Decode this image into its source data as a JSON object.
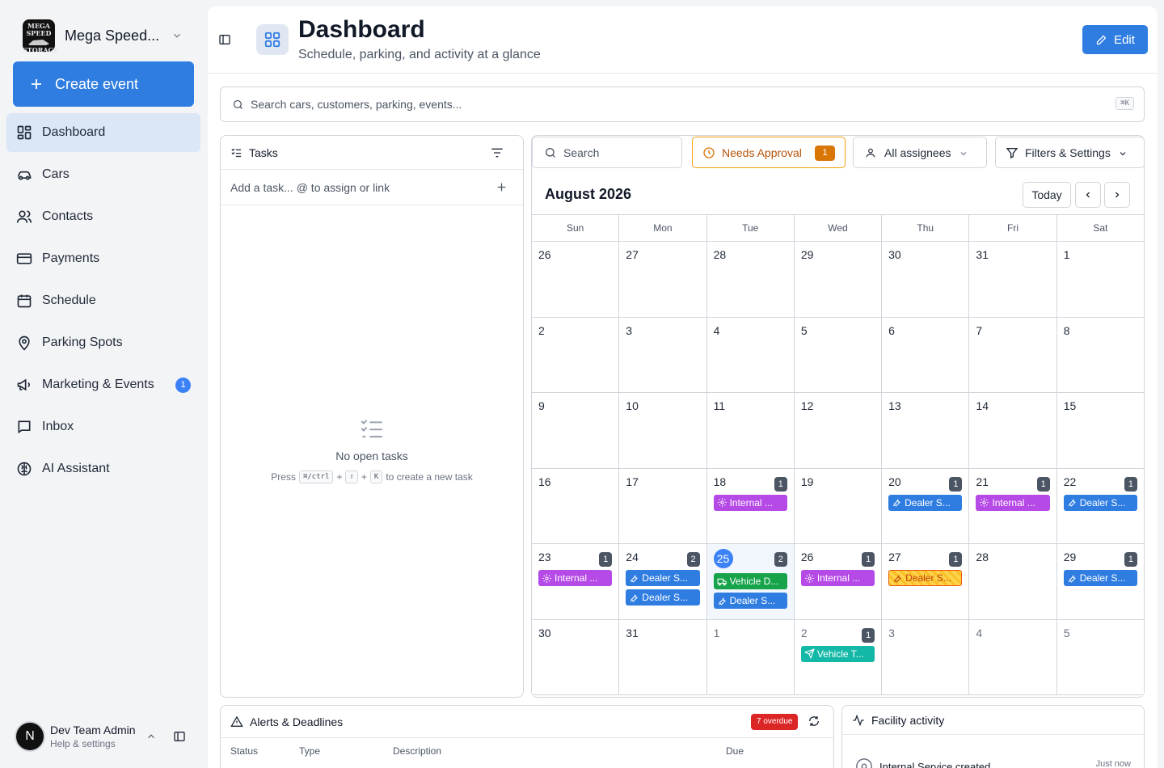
{
  "sidebar": {
    "brand": {
      "name": "Mega Speed...",
      "logo_text_top": "MEGA SPEED",
      "logo_text_bottom": "STORAGE"
    },
    "create_event_label": "Create event",
    "items": [
      {
        "label": "Dashboard",
        "icon": "dashboard-icon",
        "active": true
      },
      {
        "label": "Cars",
        "icon": "car-icon"
      },
      {
        "label": "Contacts",
        "icon": "contacts-icon"
      },
      {
        "label": "Payments",
        "icon": "credit-card-icon"
      },
      {
        "label": "Schedule",
        "icon": "calendar-icon"
      },
      {
        "label": "Parking Spots",
        "icon": "map-pin-icon"
      },
      {
        "label": "Marketing & Events",
        "icon": "megaphone-icon",
        "badge": "1"
      },
      {
        "label": "Inbox",
        "icon": "inbox-icon"
      },
      {
        "label": "AI Assistant",
        "icon": "ai-brain-icon"
      }
    ],
    "user": {
      "initial": "N",
      "name": "Dev Team Admin",
      "sub": "Help & settings"
    }
  },
  "header": {
    "title": "Dashboard",
    "subtitle": "Schedule, parking, and activity at a glance",
    "edit_label": "Edit"
  },
  "search": {
    "placeholder": "Search cars, customers, parking, events...",
    "shortcut": "⌘K"
  },
  "tasks": {
    "title": "Tasks",
    "add_placeholder": "Add a task... @ to assign or link",
    "empty_title": "No open tasks",
    "hint_press": "Press",
    "hint_key1": "⌘/ctrl",
    "hint_plus": "+",
    "hint_key2": "⇧",
    "hint_key3": "K",
    "hint_end": "to create a new task"
  },
  "calendar_toolbar": {
    "search_label": "Search",
    "approval_label": "Needs Approval",
    "approval_count": "1",
    "assignees_label": "All assignees",
    "filters_label": "Filters & Settings"
  },
  "calendar": {
    "month_title": "August 2026",
    "today_label": "Today",
    "weekdays": [
      "Sun",
      "Mon",
      "Tue",
      "Wed",
      "Thu",
      "Fri",
      "Sat"
    ],
    "weeks": [
      [
        {
          "d": "26"
        },
        {
          "d": "27"
        },
        {
          "d": "28"
        },
        {
          "d": "29"
        },
        {
          "d": "30"
        },
        {
          "d": "31"
        },
        {
          "d": "1"
        }
      ],
      [
        {
          "d": "2"
        },
        {
          "d": "3"
        },
        {
          "d": "4"
        },
        {
          "d": "5"
        },
        {
          "d": "6"
        },
        {
          "d": "7"
        },
        {
          "d": "8"
        }
      ],
      [
        {
          "d": "9"
        },
        {
          "d": "10"
        },
        {
          "d": "11"
        },
        {
          "d": "12"
        },
        {
          "d": "13"
        },
        {
          "d": "14"
        },
        {
          "d": "15"
        }
      ],
      [
        {
          "d": "16"
        },
        {
          "d": "17"
        },
        {
          "d": "18",
          "count": "1",
          "events": [
            {
              "label": "Internal ...",
              "color": "purple",
              "icon": "gear-icon"
            }
          ]
        },
        {
          "d": "19"
        },
        {
          "d": "20",
          "count": "1",
          "events": [
            {
              "label": "Dealer S...",
              "color": "blue",
              "icon": "wrench-icon"
            }
          ]
        },
        {
          "d": "21",
          "count": "1",
          "events": [
            {
              "label": "Internal ...",
              "color": "purple",
              "icon": "gear-icon"
            }
          ]
        },
        {
          "d": "22",
          "count": "1",
          "events": [
            {
              "label": "Dealer S...",
              "color": "blue",
              "icon": "wrench-icon"
            }
          ]
        }
      ],
      [
        {
          "d": "23",
          "count": "1",
          "events": [
            {
              "label": "Internal ...",
              "color": "purple",
              "icon": "gear-icon"
            }
          ]
        },
        {
          "d": "24",
          "count": "2",
          "events": [
            {
              "label": "Dealer S...",
              "color": "blue",
              "icon": "wrench-icon"
            },
            {
              "label": "Dealer S...",
              "color": "blue",
              "icon": "wrench-icon"
            }
          ]
        },
        {
          "d": "25",
          "today": true,
          "count": "2",
          "events": [
            {
              "label": "Vehicle D...",
              "color": "green",
              "icon": "truck-icon"
            },
            {
              "label": "Dealer S...",
              "color": "blue",
              "icon": "wrench-icon"
            }
          ]
        },
        {
          "d": "26",
          "count": "1",
          "events": [
            {
              "label": "Internal ...",
              "color": "purple",
              "icon": "gear-icon"
            }
          ]
        },
        {
          "d": "27",
          "count": "1",
          "events": [
            {
              "label": "Dealer S...",
              "color": "striped",
              "icon": "wrench-icon"
            }
          ]
        },
        {
          "d": "28"
        },
        {
          "d": "29",
          "count": "1",
          "events": [
            {
              "label": "Dealer S...",
              "color": "blue",
              "icon": "wrench-icon"
            }
          ]
        }
      ],
      [
        {
          "d": "30"
        },
        {
          "d": "31"
        },
        {
          "d": "1",
          "muted": true
        },
        {
          "d": "2",
          "muted": true,
          "count": "1",
          "events": [
            {
              "label": "Vehicle T...",
              "color": "teal",
              "icon": "send-icon"
            }
          ]
        },
        {
          "d": "3",
          "muted": true
        },
        {
          "d": "4",
          "muted": true
        },
        {
          "d": "5",
          "muted": true
        }
      ]
    ]
  },
  "alerts": {
    "title": "Alerts & Deadlines",
    "overdue_badge": "7 overdue",
    "columns": [
      "Status",
      "Type",
      "Description",
      "Due"
    ]
  },
  "facility": {
    "title": "Facility activity",
    "item_label": "Internal Service created",
    "item_time": "Just now"
  },
  "colors": {
    "accent": "#2f7de1",
    "purple": "#b54ae6",
    "green": "#16a34a",
    "teal": "#14b8a6",
    "warning": "#d97706",
    "danger": "#dc2626"
  }
}
